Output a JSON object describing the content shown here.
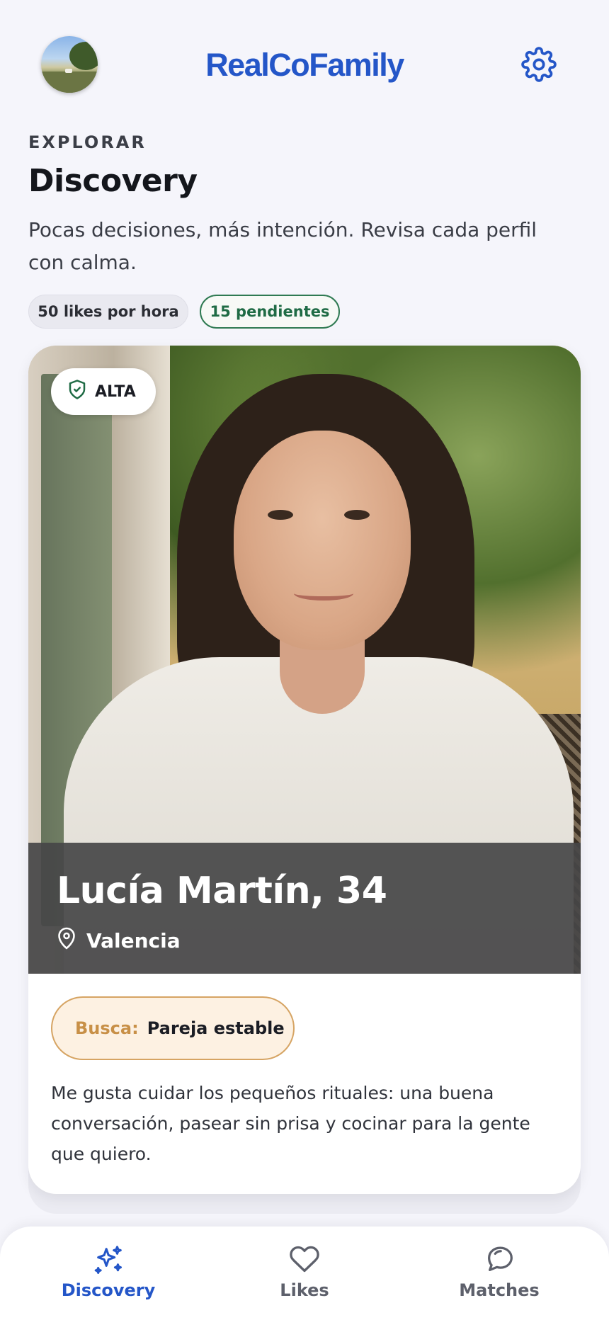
{
  "header": {
    "brand": "RealCoFamily",
    "avatar_icon": "user-avatar",
    "settings_icon": "gear-icon"
  },
  "intro": {
    "eyebrow": "EXPLORAR",
    "title": "Discovery",
    "subtitle": "Pocas decisiones, más intención. Revisa cada perfil con calma."
  },
  "chips": {
    "likes": "50 likes por hora",
    "pending": "15 pendientes"
  },
  "profile": {
    "badge": "ALTA",
    "badge_icon": "shield-check-icon",
    "name": "Lucía Martín, 34",
    "location": "Valencia",
    "location_icon": "map-pin-icon",
    "seeking_label": "Busca:",
    "seeking_value": "Pareja estable",
    "bio": "Me gusta cuidar los pequeños rituales: una buena conversación, pasear sin prisa y cocinar para la gente que quiero."
  },
  "nav": {
    "items": [
      {
        "label": "Discovery",
        "icon": "sparkles-icon",
        "active": true
      },
      {
        "label": "Likes",
        "icon": "heart-icon",
        "active": false
      },
      {
        "label": "Matches",
        "icon": "chat-bubbles-icon",
        "active": false
      }
    ]
  },
  "colors": {
    "accent": "#2456c8",
    "background": "#f5f5fb",
    "pending_green": "#2f7a52",
    "seeking_border": "#d6a463"
  }
}
